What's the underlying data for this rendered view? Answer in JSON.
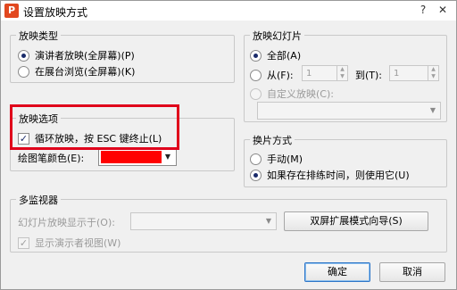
{
  "window": {
    "title": "设置放映方式",
    "help_label": "?",
    "close_label": "✕"
  },
  "show_type": {
    "legend": "放映类型",
    "opt_speaker": "演讲者放映(全屏幕)(P)",
    "opt_kiosk": "在展台浏览(全屏幕)(K)"
  },
  "slides": {
    "legend": "放映幻灯片",
    "opt_all": "全部(A)",
    "opt_from": "从(F):",
    "from_value": "1",
    "to_label": "到(T):",
    "to_value": "1",
    "opt_custom": "自定义放映(C):"
  },
  "options": {
    "legend": "放映选项",
    "loop_label": "循环放映，按 ESC 键终止(L)",
    "pen_color_label": "绘图笔颜色(E):",
    "pen_color": "#ff0000"
  },
  "advance": {
    "legend": "换片方式",
    "opt_manual": "手动(M)",
    "opt_timings": "如果存在排练时间，则使用它(U)"
  },
  "monitors": {
    "legend": "多监视器",
    "display_on_label": "幻灯片放映显示于(O):",
    "wizard_button": "双屏扩展模式向导(S)",
    "presenter_view_label": "显示演示者视图(W)"
  },
  "buttons": {
    "ok": "确定",
    "cancel": "取消"
  },
  "colors": {
    "highlight_box": "#e0001b",
    "accent": "#2e76c8"
  }
}
